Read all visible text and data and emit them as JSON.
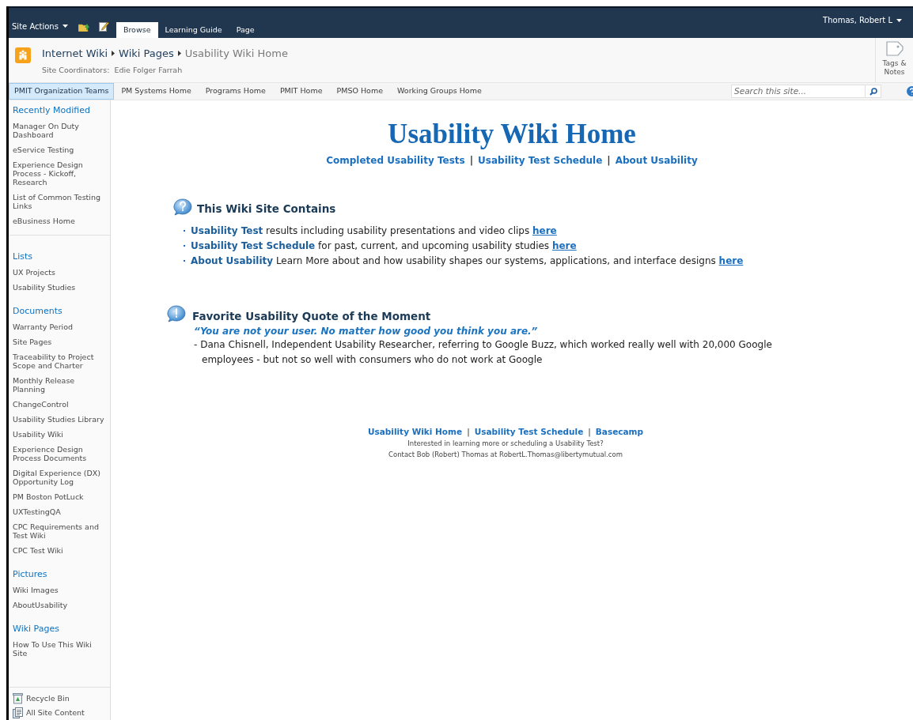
{
  "ribbon": {
    "site_actions": "Site Actions",
    "tabs": [
      {
        "label": "Browse",
        "selected": true
      },
      {
        "label": "Learning Guide",
        "selected": false
      },
      {
        "label": "Page",
        "selected": false
      }
    ],
    "user": "Thomas, Robert L"
  },
  "title_area": {
    "breadcrumb": [
      "Internet Wiki",
      "Wiki Pages",
      "Usability Wiki Home"
    ],
    "coordinators_label": "Site Coordinators:",
    "coordinators": "Edie Folger Farrah",
    "tags_notes": "Tags & Notes"
  },
  "top_nav": {
    "items": [
      {
        "label": "PMIT Organization Teams",
        "selected": true
      },
      {
        "label": "PM Systems Home",
        "selected": false
      },
      {
        "label": "Programs Home",
        "selected": false
      },
      {
        "label": "PMIT Home",
        "selected": false
      },
      {
        "label": "PMSO Home",
        "selected": false
      },
      {
        "label": "Working Groups Home",
        "selected": false
      }
    ],
    "search": {
      "placeholder": "Search this site..."
    }
  },
  "sidebar": {
    "sections": [
      {
        "heading": "Recently Modified",
        "divider": true,
        "items": [
          "Manager On Duty Dashboard",
          "eService Testing",
          "Experience Design Process - Kickoff, Research",
          "List of Common Testing Links",
          "eBusiness Home"
        ]
      },
      {
        "heading": "Lists",
        "divider": false,
        "items": [
          "UX Projects",
          "Usability Studies"
        ]
      },
      {
        "heading": "Documents",
        "divider": false,
        "items": [
          "Warranty Period",
          "Site Pages",
          "Traceability to Project Scope and Charter",
          "Monthly Release Planning",
          "ChangeControl",
          "Usability Studies Library",
          "Usability Wiki",
          "Experience Design Process Documents",
          "Digital Experience (DX) Opportunity Log",
          "PM Boston PotLuck",
          "UXTestingQA",
          "CPC Requirements and Test Wiki",
          "CPC Test Wiki"
        ]
      },
      {
        "heading": "Pictures",
        "divider": false,
        "items": [
          "Wiki Images",
          "AboutUsability"
        ]
      },
      {
        "heading": "Wiki Pages",
        "divider": false,
        "items": [
          "How To Use This Wiki Site"
        ]
      }
    ],
    "footer": [
      {
        "kind": "recycle",
        "label": "Recycle Bin"
      },
      {
        "kind": "content",
        "label": "All Site Content"
      }
    ]
  },
  "content": {
    "title": "Usability Wiki Home",
    "links": [
      {
        "kind": "link",
        "text": "Completed Usability Tests"
      },
      {
        "kind": "separator",
        "text": "|"
      },
      {
        "kind": "link",
        "text": "Usability Test Schedule"
      },
      {
        "kind": "separator",
        "text": "|"
      },
      {
        "kind": "link",
        "text": "About Usability"
      }
    ],
    "contains": {
      "heading": "This Wiki Site Contains",
      "bullets": [
        {
          "lead": "Usability Test",
          "text": "results including usability presentations and video clips",
          "link": "here"
        },
        {
          "lead": "Usability Test Schedule",
          "text": "for past, current, and upcoming usability studies",
          "link": "here"
        },
        {
          "lead": "About Usability",
          "text": "Learn More about and how usability shapes our systems, applications, and interface designs",
          "link": "here"
        }
      ]
    },
    "quote": {
      "heading": "Favorite Usability Quote of the Moment",
      "quote": "“You are not your user. No matter how good you think you are.”",
      "attribution": "- Dana Chisnell, Independent Usability Researcher, referring to Google Buzz, which worked really well with 20,000 Google employees - but not so well with consumers who do not work at Google"
    },
    "footer": {
      "links": [
        {
          "kind": "link",
          "text": "Usability Wiki Home"
        },
        {
          "kind": "separator",
          "text": "|"
        },
        {
          "kind": "link",
          "text": "Usability Test Schedule"
        },
        {
          "kind": "separator",
          "text": "|"
        },
        {
          "kind": "link",
          "text": "Basecamp"
        }
      ],
      "lines": [
        "Interested in learning more or scheduling a Usability Test?",
        "Contact Bob (Robert) Thomas at RobertL.Thomas@libertymutual.com"
      ]
    }
  }
}
